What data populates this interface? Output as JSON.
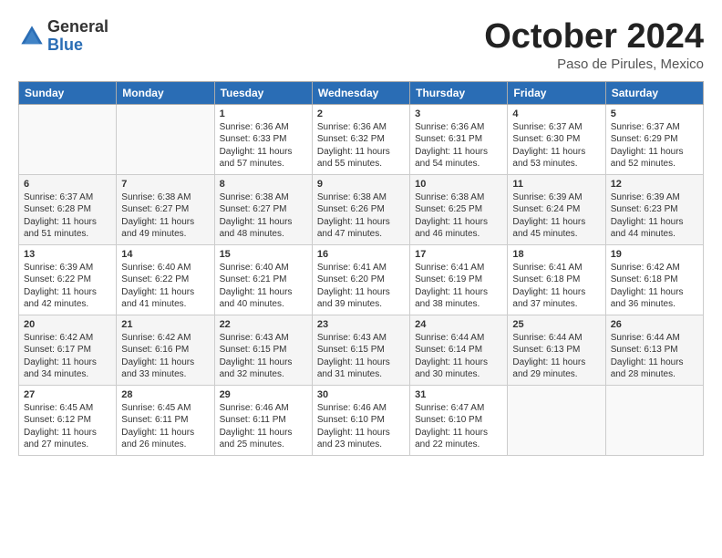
{
  "logo": {
    "general": "General",
    "blue": "Blue"
  },
  "title": "October 2024",
  "location": "Paso de Pirules, Mexico",
  "weekdays": [
    "Sunday",
    "Monday",
    "Tuesday",
    "Wednesday",
    "Thursday",
    "Friday",
    "Saturday"
  ],
  "weeks": [
    [
      {
        "day": "",
        "info": ""
      },
      {
        "day": "",
        "info": ""
      },
      {
        "day": "1",
        "info": "Sunrise: 6:36 AM\nSunset: 6:33 PM\nDaylight: 11 hours and 57 minutes."
      },
      {
        "day": "2",
        "info": "Sunrise: 6:36 AM\nSunset: 6:32 PM\nDaylight: 11 hours and 55 minutes."
      },
      {
        "day": "3",
        "info": "Sunrise: 6:36 AM\nSunset: 6:31 PM\nDaylight: 11 hours and 54 minutes."
      },
      {
        "day": "4",
        "info": "Sunrise: 6:37 AM\nSunset: 6:30 PM\nDaylight: 11 hours and 53 minutes."
      },
      {
        "day": "5",
        "info": "Sunrise: 6:37 AM\nSunset: 6:29 PM\nDaylight: 11 hours and 52 minutes."
      }
    ],
    [
      {
        "day": "6",
        "info": "Sunrise: 6:37 AM\nSunset: 6:28 PM\nDaylight: 11 hours and 51 minutes."
      },
      {
        "day": "7",
        "info": "Sunrise: 6:38 AM\nSunset: 6:27 PM\nDaylight: 11 hours and 49 minutes."
      },
      {
        "day": "8",
        "info": "Sunrise: 6:38 AM\nSunset: 6:27 PM\nDaylight: 11 hours and 48 minutes."
      },
      {
        "day": "9",
        "info": "Sunrise: 6:38 AM\nSunset: 6:26 PM\nDaylight: 11 hours and 47 minutes."
      },
      {
        "day": "10",
        "info": "Sunrise: 6:38 AM\nSunset: 6:25 PM\nDaylight: 11 hours and 46 minutes."
      },
      {
        "day": "11",
        "info": "Sunrise: 6:39 AM\nSunset: 6:24 PM\nDaylight: 11 hours and 45 minutes."
      },
      {
        "day": "12",
        "info": "Sunrise: 6:39 AM\nSunset: 6:23 PM\nDaylight: 11 hours and 44 minutes."
      }
    ],
    [
      {
        "day": "13",
        "info": "Sunrise: 6:39 AM\nSunset: 6:22 PM\nDaylight: 11 hours and 42 minutes."
      },
      {
        "day": "14",
        "info": "Sunrise: 6:40 AM\nSunset: 6:22 PM\nDaylight: 11 hours and 41 minutes."
      },
      {
        "day": "15",
        "info": "Sunrise: 6:40 AM\nSunset: 6:21 PM\nDaylight: 11 hours and 40 minutes."
      },
      {
        "day": "16",
        "info": "Sunrise: 6:41 AM\nSunset: 6:20 PM\nDaylight: 11 hours and 39 minutes."
      },
      {
        "day": "17",
        "info": "Sunrise: 6:41 AM\nSunset: 6:19 PM\nDaylight: 11 hours and 38 minutes."
      },
      {
        "day": "18",
        "info": "Sunrise: 6:41 AM\nSunset: 6:18 PM\nDaylight: 11 hours and 37 minutes."
      },
      {
        "day": "19",
        "info": "Sunrise: 6:42 AM\nSunset: 6:18 PM\nDaylight: 11 hours and 36 minutes."
      }
    ],
    [
      {
        "day": "20",
        "info": "Sunrise: 6:42 AM\nSunset: 6:17 PM\nDaylight: 11 hours and 34 minutes."
      },
      {
        "day": "21",
        "info": "Sunrise: 6:42 AM\nSunset: 6:16 PM\nDaylight: 11 hours and 33 minutes."
      },
      {
        "day": "22",
        "info": "Sunrise: 6:43 AM\nSunset: 6:15 PM\nDaylight: 11 hours and 32 minutes."
      },
      {
        "day": "23",
        "info": "Sunrise: 6:43 AM\nSunset: 6:15 PM\nDaylight: 11 hours and 31 minutes."
      },
      {
        "day": "24",
        "info": "Sunrise: 6:44 AM\nSunset: 6:14 PM\nDaylight: 11 hours and 30 minutes."
      },
      {
        "day": "25",
        "info": "Sunrise: 6:44 AM\nSunset: 6:13 PM\nDaylight: 11 hours and 29 minutes."
      },
      {
        "day": "26",
        "info": "Sunrise: 6:44 AM\nSunset: 6:13 PM\nDaylight: 11 hours and 28 minutes."
      }
    ],
    [
      {
        "day": "27",
        "info": "Sunrise: 6:45 AM\nSunset: 6:12 PM\nDaylight: 11 hours and 27 minutes."
      },
      {
        "day": "28",
        "info": "Sunrise: 6:45 AM\nSunset: 6:11 PM\nDaylight: 11 hours and 26 minutes."
      },
      {
        "day": "29",
        "info": "Sunrise: 6:46 AM\nSunset: 6:11 PM\nDaylight: 11 hours and 25 minutes."
      },
      {
        "day": "30",
        "info": "Sunrise: 6:46 AM\nSunset: 6:10 PM\nDaylight: 11 hours and 23 minutes."
      },
      {
        "day": "31",
        "info": "Sunrise: 6:47 AM\nSunset: 6:10 PM\nDaylight: 11 hours and 22 minutes."
      },
      {
        "day": "",
        "info": ""
      },
      {
        "day": "",
        "info": ""
      }
    ]
  ]
}
